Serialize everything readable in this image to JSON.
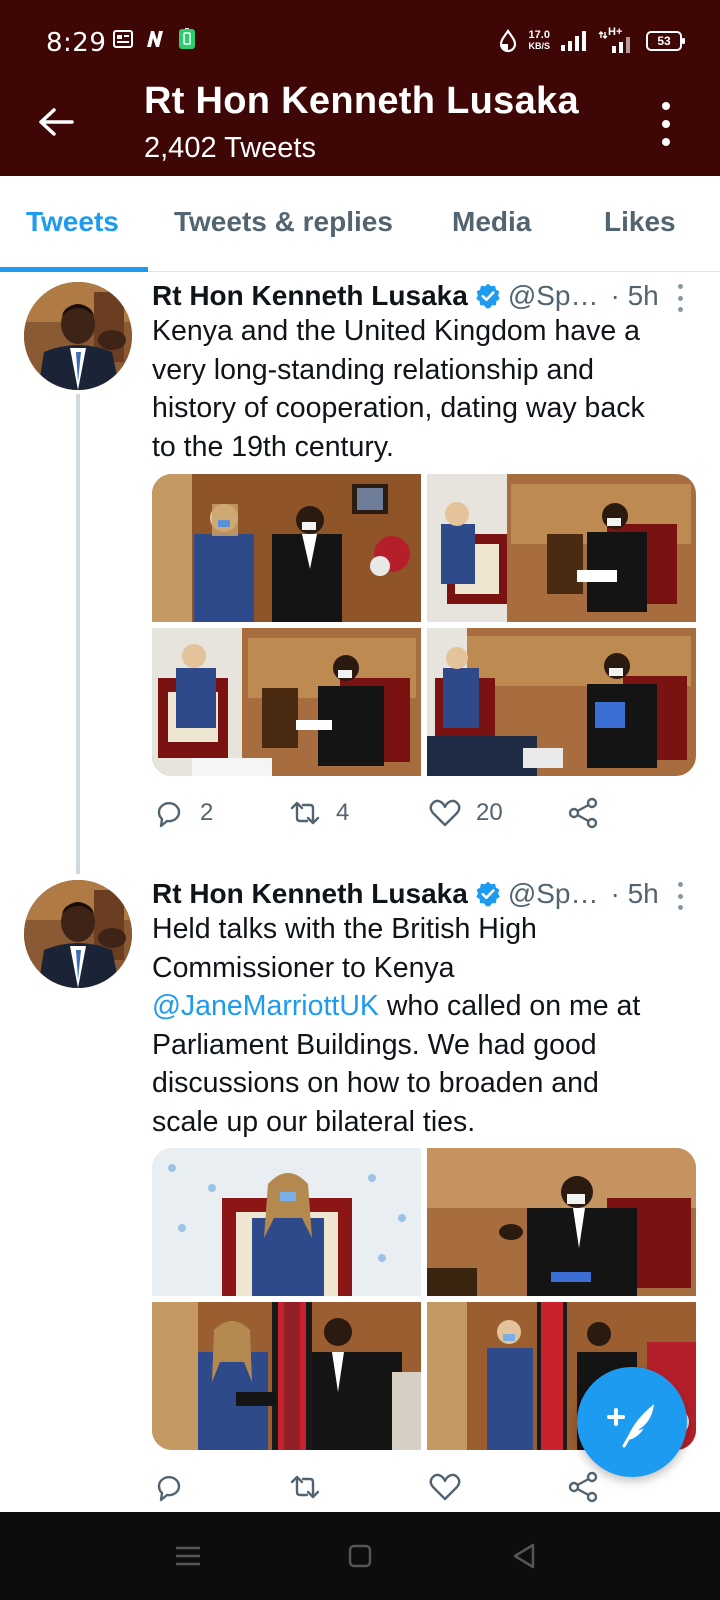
{
  "status_bar": {
    "time": "8:29",
    "net_speed_value": "17.0",
    "net_speed_unit": "KB/S",
    "network_type": "H+",
    "battery": "53"
  },
  "header": {
    "title": "Rt Hon Kenneth Lusaka",
    "subtitle": "2,402 Tweets"
  },
  "tabs": [
    {
      "label": "Tweets",
      "active": true
    },
    {
      "label": "Tweets & replies",
      "active": false
    },
    {
      "label": "Media",
      "active": false
    },
    {
      "label": "Likes",
      "active": false
    }
  ],
  "tweets": [
    {
      "name": "Rt Hon Kenneth Lusaka",
      "handle": "@Sp…",
      "time": "· 5h",
      "text_lines": [
        "Kenya and the United Kingdom have a",
        "very long-standing relationship and",
        "history of cooperation, dating way back",
        "to the 19th century."
      ],
      "replies": "2",
      "retweets": "4",
      "likes": "20"
    },
    {
      "name": "Rt Hon Kenneth Lusaka",
      "handle": "@Sp…",
      "time": "· 5h",
      "text_before": "Held talks with the British High",
      "text_line2": "Commissioner to Kenya",
      "mention": "@JaneMarriottUK",
      "text_after_mention": " who called on me at",
      "text_lines_rest": [
        "Parliament Buildings. We had good",
        "discussions on how to broaden and",
        "scale up our bilateral ties."
      ]
    }
  ],
  "colors": {
    "header_bg": "#3f0606",
    "accent": "#1d9bf0",
    "muted": "#536471"
  }
}
